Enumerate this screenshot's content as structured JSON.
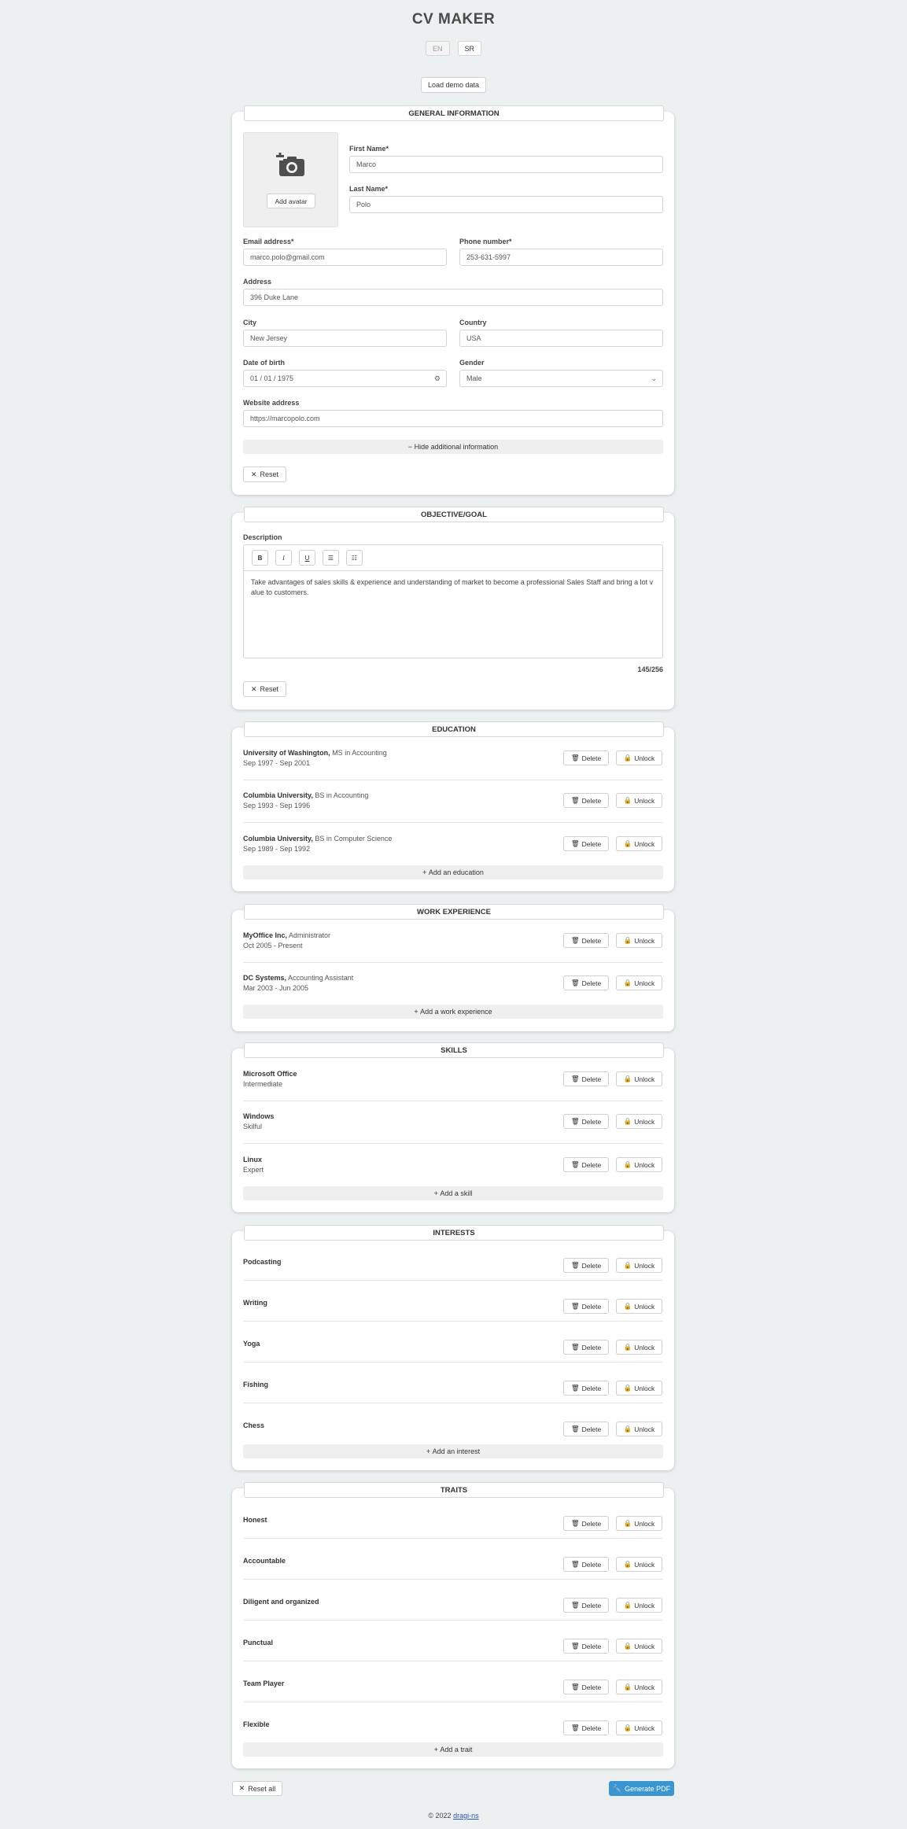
{
  "app_title": "CV MAKER",
  "languages": [
    "EN",
    "SR"
  ],
  "load_demo_label": "Load demo data",
  "general": {
    "title": "GENERAL INFORMATION",
    "add_avatar_label": "Add avatar",
    "first_name": {
      "label": "First Name*",
      "value": "Marco"
    },
    "last_name": {
      "label": "Last Name*",
      "value": "Polo"
    },
    "email": {
      "label": "Email address*",
      "value": "marco.polo@gmail.com"
    },
    "phone": {
      "label": "Phone number*",
      "value": "253-631-5997"
    },
    "address": {
      "label": "Address",
      "value": "396 Duke Lane"
    },
    "city": {
      "label": "City",
      "value": "New Jersey"
    },
    "country": {
      "label": "Country",
      "value": "USA"
    },
    "dob": {
      "label": "Date of birth",
      "value": "01 / 01 / 1975"
    },
    "gender": {
      "label": "Gender",
      "value": "Male"
    },
    "website": {
      "label": "Website address",
      "value": "https://marcopolo.com"
    },
    "hide_additional_label": "Hide additional information",
    "reset_label": "Reset"
  },
  "objective": {
    "title": "OBJECTIVE/GOAL",
    "description_label": "Description",
    "text": "Take advantages of sales skills & experience and understanding of market to become a professional Sales Staff and bring a lot value to customers.",
    "counter": "145/256",
    "reset_label": "Reset"
  },
  "education": {
    "title": "EDUCATION",
    "items": [
      {
        "school": "University of Washington,",
        "degree": "MS in Accounting",
        "dates": "Sep 1997 - Sep 2001"
      },
      {
        "school": "Columbia University,",
        "degree": "BS in Accounting",
        "dates": "Sep 1993 - Sep 1996"
      },
      {
        "school": "Columbia University,",
        "degree": "BS in Computer Science",
        "dates": "Sep 1989 - Sep 1992"
      }
    ],
    "add_label": "Add an education"
  },
  "work": {
    "title": "WORK EXPERIENCE",
    "items": [
      {
        "company": "MyOffice Inc,",
        "role": "Administrator",
        "dates": "Oct 2005 - Present"
      },
      {
        "company": "DC Systems,",
        "role": "Accounting Assistant",
        "dates": "Mar 2003 - Jun 2005"
      }
    ],
    "add_label": "Add a work experience"
  },
  "skills": {
    "title": "SKILLS",
    "items": [
      {
        "name": "Microsoft Office",
        "level": "Intermediate"
      },
      {
        "name": "Windows",
        "level": "Skilful"
      },
      {
        "name": "Linux",
        "level": "Expert"
      }
    ],
    "add_label": "Add a skill"
  },
  "interests": {
    "title": "INTERESTS",
    "items": [
      "Podcasting",
      "Writing",
      "Yoga",
      "Fishing",
      "Chess"
    ],
    "add_label": "Add an interest"
  },
  "traits": {
    "title": "TRAITS",
    "items": [
      "Honest",
      "Accountable",
      "Diligent and organized",
      "Punctual",
      "Team Player",
      "Flexible"
    ],
    "add_label": "Add a trait"
  },
  "buttons": {
    "delete": "Delete",
    "unlock": "Unlock"
  },
  "reset_all_label": "Reset all",
  "generate_pdf_label": "Generate PDF",
  "footer": {
    "text": "© 2022",
    "link": "dragi-ns"
  },
  "colors": {
    "primary": "#3896d3",
    "background": "#edf0f1"
  }
}
